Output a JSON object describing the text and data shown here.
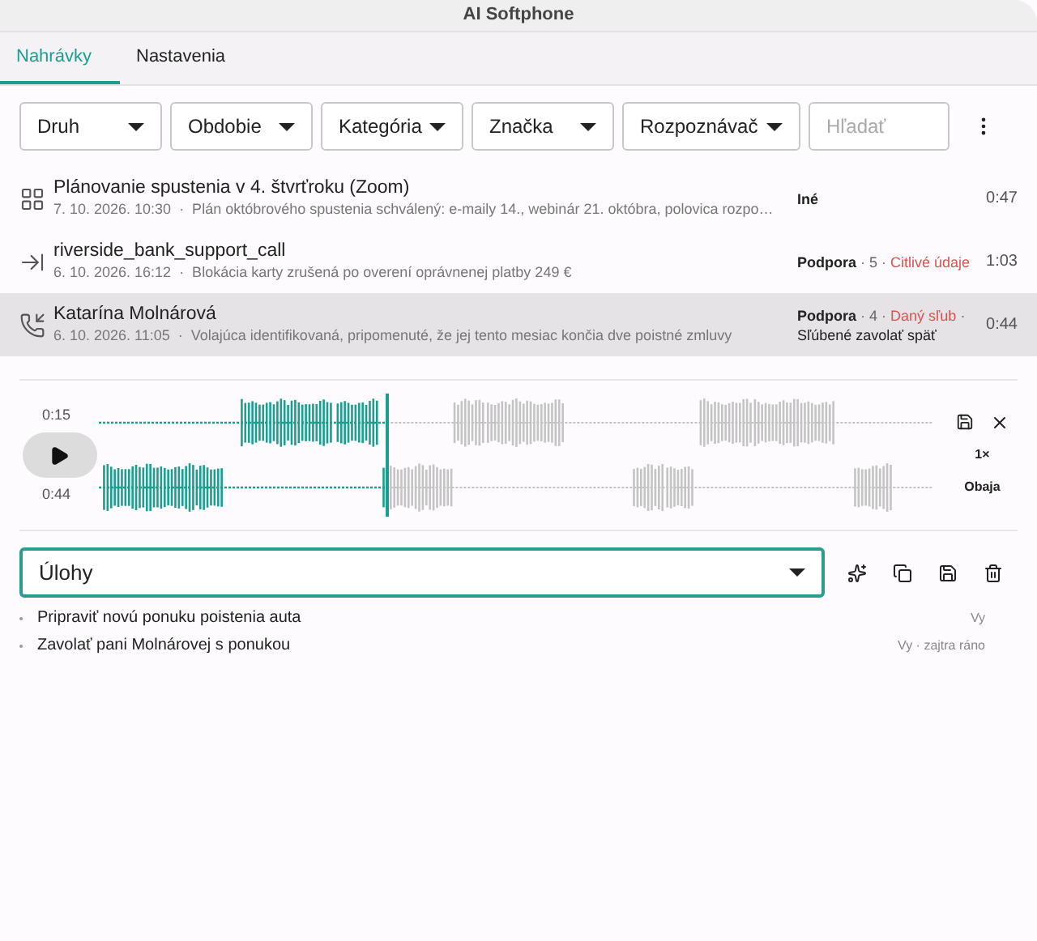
{
  "window": {
    "title": "AI Softphone"
  },
  "tabs": [
    {
      "label": "Nahrávky",
      "selected": true
    },
    {
      "label": "Nastavenia",
      "selected": false
    }
  ],
  "filters": [
    {
      "label": "Druh"
    },
    {
      "label": "Obdobie"
    },
    {
      "label": "Kategória"
    },
    {
      "label": "Značka"
    },
    {
      "label": "Rozpoznávač"
    }
  ],
  "search": {
    "placeholder": "Hľadať"
  },
  "recordings": [
    {
      "kind": "meeting",
      "title": "Plánovanie spustenia v 4. štvrťroku (Zoom)",
      "subtitle": "7. 10. 2026. 10:30  ·  Plán októbrového spustenia schválený: e-maily 14., webinár 21. októbra, polovica rozpo…",
      "tags": [
        {
          "kind": "category",
          "text": "Iné"
        }
      ],
      "duration": "0:47",
      "selected": false
    },
    {
      "kind": "import",
      "title": "riverside_bank_support_call",
      "subtitle": "6. 10. 2026. 16:12  ·  Blokácia karty zrušená po overení oprávnenej platby 249 €",
      "tags": [
        {
          "kind": "category",
          "text": "Podpora"
        },
        {
          "kind": "plain",
          "text": " · 5 · "
        },
        {
          "kind": "flag",
          "text": "Citlivé údaje"
        }
      ],
      "duration": "1:03",
      "selected": false
    },
    {
      "kind": "incoming",
      "title": "Katarína Molnárová",
      "subtitle": "6. 10. 2026. 11:05  ·  Volajúca identifikovaná, pripomenuté, že jej tento mesiac končia dve poistné zmluvy",
      "tags": [
        {
          "kind": "category",
          "text": "Podpora"
        },
        {
          "kind": "plain",
          "text": " · 4 · "
        },
        {
          "kind": "flag",
          "text": "Daný sľub"
        },
        {
          "kind": "plain",
          "text": " ·"
        }
      ],
      "note": "Sľúbené zavolať späť",
      "duration": "0:44",
      "selected": true
    }
  ],
  "player": {
    "elapsed": "0:15",
    "total": "0:44",
    "level": 0.345,
    "speed": "1×",
    "channels": "Obaja"
  },
  "tasks": {
    "label": "Úlohy",
    "items": [
      {
        "text": "Pripraviť novú ponuku poistenia auta",
        "assignee": "Vy"
      },
      {
        "text": "Zavolať pani Molnárovej s ponukou",
        "assignee": "Vy · zajtra ráno"
      }
    ]
  }
}
